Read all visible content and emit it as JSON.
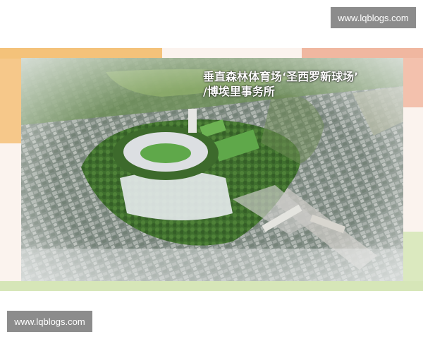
{
  "watermark": {
    "top_text": "www.lqblogs.com",
    "bottom_text": "www.lqblogs.com"
  },
  "photo": {
    "caption_line1": "垂直森林体育场‘圣西罗新球场’",
    "caption_line2": "/博埃里事务所"
  },
  "colors": {
    "watermark_bg": "#8c8c8c",
    "frame_bg": "#fbf3ee",
    "accent_orange": "#f4c27a",
    "accent_pink": "#f0b7a0",
    "accent_green": "#d6e6b8",
    "field_green": "#5fa84a",
    "tree_green": "#3f6f2e"
  }
}
